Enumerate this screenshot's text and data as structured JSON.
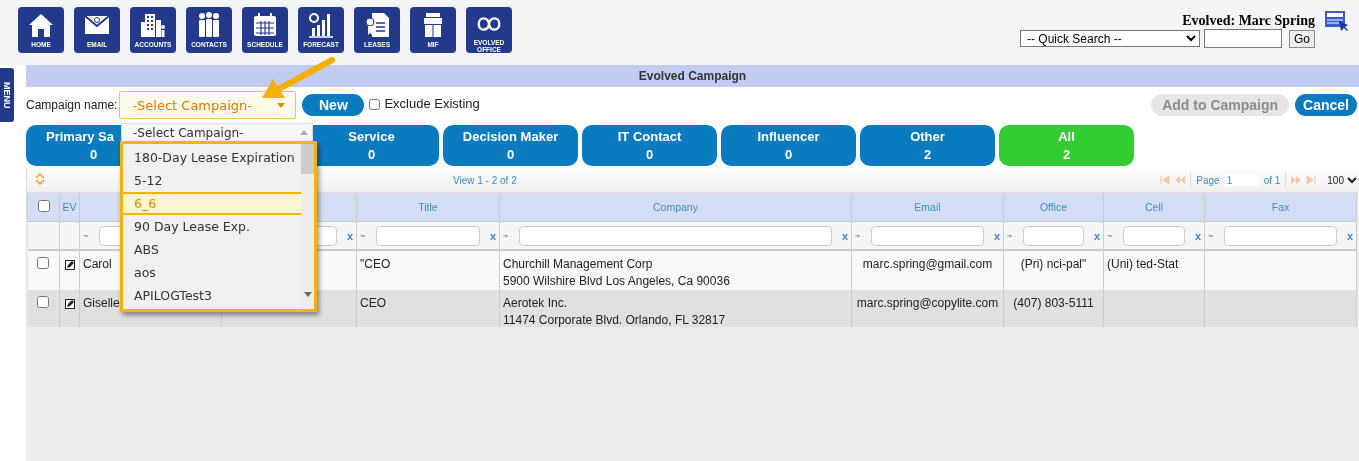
{
  "nav": [
    {
      "label": "HOME",
      "kind": "home"
    },
    {
      "label": "EMAIL",
      "kind": "email"
    },
    {
      "label": "ACCOUNTS",
      "kind": "accounts"
    },
    {
      "label": "CONTACTS",
      "kind": "contacts"
    },
    {
      "label": "SCHEDULE",
      "kind": "schedule"
    },
    {
      "label": "FORECAST",
      "kind": "forecast"
    },
    {
      "label": "LEASES",
      "kind": "leases"
    },
    {
      "label": "MIF",
      "kind": "mif"
    },
    {
      "label": "EVOLVED OFFICE",
      "kind": "office"
    }
  ],
  "user": "Evolved: Marc Spring",
  "quick_search": {
    "value": "-- Quick Search --",
    "go": "Go"
  },
  "menu_tab": "MENU",
  "title_bar": "Evolved Campaign",
  "campaign": {
    "label": "Campaign name:",
    "value": "-Select Campaign-",
    "expanded": true,
    "options": [
      {
        "label": "-Select Campaign-",
        "highlighted": false
      },
      {
        "label": "180-Day Lease Expiration",
        "highlighted": false
      },
      {
        "label": "5-12",
        "highlighted": false
      },
      {
        "label": "6_6",
        "highlighted": true
      },
      {
        "label": "90 Day Lease Exp.",
        "highlighted": false
      },
      {
        "label": "ABS",
        "highlighted": false
      },
      {
        "label": "aos",
        "highlighted": false
      },
      {
        "label": "APILOGTest3",
        "highlighted": false
      }
    ]
  },
  "new_button": "New",
  "exclude_existing": {
    "label": "Exclude Existing",
    "checked": false
  },
  "add_button": {
    "label": "Add to Campaign",
    "disabled": true
  },
  "cancel_button": "Cancel",
  "tabs": [
    {
      "label": "Primary Sa",
      "count": "0",
      "selected": false
    },
    {
      "label": "Service",
      "count": "0",
      "selected": false
    },
    {
      "label": "Decision Maker",
      "count": "0",
      "selected": false
    },
    {
      "label": "IT Contact",
      "count": "0",
      "selected": false
    },
    {
      "label": "Influencer",
      "count": "0",
      "selected": false
    },
    {
      "label": "Other",
      "count": "2",
      "selected": false
    },
    {
      "label": "All",
      "count": "2",
      "selected": true
    }
  ],
  "pager": {
    "view": "View 1 - 2 of 2",
    "page_label": "Page",
    "page": "1",
    "of": "of 1",
    "page_size": "100"
  },
  "table": {
    "select_all": {
      "checked": false
    },
    "columns": [
      {
        "kind": "check"
      },
      {
        "kind": "edit",
        "label": "EV"
      },
      {
        "kind": "text",
        "filter": {
          "prefix": "~"
        }
      },
      {
        "kind": "text",
        "filter": {
          "clear": "x"
        }
      },
      {
        "kind": "text",
        "label": "Title",
        "filter": {
          "prefix": "~",
          "clear": "x"
        }
      },
      {
        "kind": "company",
        "label": "Company",
        "filter": {
          "prefix": "~",
          "clear": "x"
        }
      },
      {
        "kind": "text",
        "label": "Email",
        "filter": {
          "prefix": "~",
          "clear": "x"
        }
      },
      {
        "kind": "text",
        "label": "Office",
        "filter": {
          "prefix": "~",
          "clear": "x"
        }
      },
      {
        "kind": "text",
        "label": "Cell",
        "filter": {
          "prefix": "~",
          "clear": "x"
        }
      },
      {
        "kind": "text",
        "label": "Fax",
        "filter": {
          "prefix": "~",
          "clear": "x"
        }
      }
    ],
    "rows": [
      {
        "checked": false,
        "cells": [
          null,
          null,
          "Carol",
          null,
          "\"CEO",
          {
            "name": "Churchill Management Corp",
            "address": "5900 Wilshire Blvd Los Angeles, Ca 90036"
          },
          "marc.spring@gmail.com",
          "(Pri) nci-pal\"",
          "(Uni) ted-Stat",
          null
        ]
      },
      {
        "checked": false,
        "cells": [
          null,
          null,
          "Giselle",
          null,
          "CEO",
          {
            "name": "Aerotek Inc.",
            "address": "11474 Corporate Blvd. Orlando, FL 32817"
          },
          "marc.spring@copylite.com",
          "(407) 803-5111",
          null,
          null
        ]
      }
    ]
  }
}
